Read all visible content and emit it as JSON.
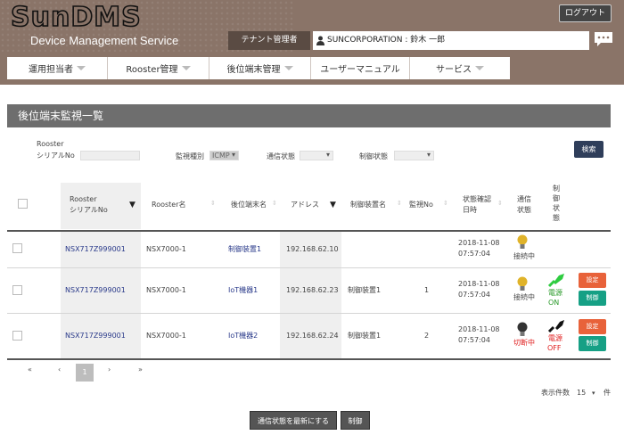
{
  "header": {
    "logo": "SunDMS",
    "subtitle": "Device Management Service",
    "logout": "ログアウト",
    "tenant_label": "テナント管理者",
    "user": "SUNCORPORATION : 鈴木 一郎"
  },
  "nav": [
    {
      "label": "運用担当者",
      "has_caret": true
    },
    {
      "label": "Rooster管理",
      "has_caret": true
    },
    {
      "label": "後位端末管理",
      "has_caret": true
    },
    {
      "label": "ユーザーマニュアル",
      "has_caret": false
    },
    {
      "label": "サービス",
      "has_caret": true
    }
  ],
  "page_title": "後位端末監視一覧",
  "filters": {
    "serial_label_1": "Rooster",
    "serial_label_2": "シリアルNo",
    "monitor_type_label": "監視種別",
    "monitor_type_value": "ICMP",
    "comm_status_label": "通信状態",
    "control_status_label": "制御状態",
    "search_button": "検索"
  },
  "table": {
    "headers": {
      "serial_1": "Rooster",
      "serial_2": "シリアルNo",
      "rooster_name": "Rooster名",
      "device_name": "後位端末名",
      "address": "アドレス",
      "control_device": "制御装置名",
      "monitor_no": "監視No",
      "status_check_1": "状態確認",
      "status_check_2": "日時",
      "comm_1": "通信",
      "comm_2": "状態",
      "ctrl_1": "制",
      "ctrl_2": "御",
      "ctrl_3": "状",
      "ctrl_4": "態"
    },
    "rows": [
      {
        "serial": "NSX717Z999001",
        "rooster_name": "NSX7000-1",
        "device": "制御装置1",
        "address": "192.168.62.10",
        "control_device": "",
        "monitor_no": "",
        "date": "2018-11-08",
        "time": "07:57:04",
        "comm_status": "接続中",
        "comm_color": "#e0b32a",
        "power_label_1": "",
        "power_label_2": "",
        "has_buttons": false
      },
      {
        "serial": "NSX717Z999001",
        "rooster_name": "NSX7000-1",
        "device": "IoT機器1",
        "address": "192.168.62.23",
        "control_device": "制御装置1",
        "monitor_no": "1",
        "date": "2018-11-08",
        "time": "07:57:04",
        "comm_status": "接続中",
        "comm_color": "#e0b32a",
        "power_label_1": "電源",
        "power_label_2": "ON",
        "power_color": "#2ecc40",
        "has_buttons": true
      },
      {
        "serial": "NSX717Z999001",
        "rooster_name": "NSX7000-1",
        "device": "IoT機器2",
        "address": "192.168.62.24",
        "control_device": "制御装置1",
        "monitor_no": "2",
        "date": "2018-11-08",
        "time": "07:57:04",
        "comm_status": "切断中",
        "comm_color": "#333333",
        "power_label_1": "電源",
        "power_label_2": "OFF",
        "power_color": "#e02020",
        "has_buttons": true
      }
    ],
    "setting_button": "設定",
    "control_button": "制御"
  },
  "pager": {
    "first": "«",
    "prev": "‹",
    "current": "1",
    "next": "›",
    "last": "»",
    "page_size_label": "表示件数",
    "page_size_value": "15",
    "page_size_unit": "件"
  },
  "footer": {
    "refresh_button": "通信状態を最新にする",
    "control_button": "制御"
  },
  "colors": {
    "header_bg": "#8a7468",
    "title_bar": "#6e6e6e",
    "search_btn": "#2f3e5a",
    "setting_btn": "#e8623a",
    "control_btn": "#16a085"
  }
}
